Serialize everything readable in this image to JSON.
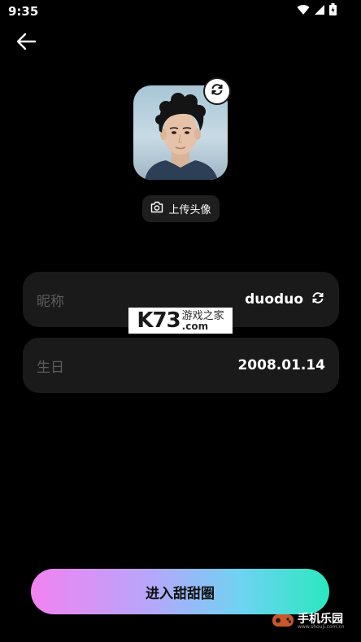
{
  "status_bar": {
    "time": "9:35"
  },
  "profile": {
    "upload_avatar_label": "上传头像"
  },
  "fields": [
    {
      "label": "昵称",
      "value": "duoduo"
    },
    {
      "label": "生日",
      "value": "2008.01.14"
    }
  ],
  "watermark": {
    "main": "K73",
    "cn": "游戏之家",
    "domain": ".com"
  },
  "enter_button": {
    "label": "进入甜甜圈"
  },
  "corner_logo": {
    "cn": "手机乐园",
    "url": "www.shouji.com.cn"
  },
  "colors": {
    "background": "#000000",
    "field_bg": "#1a1a1a",
    "label_gray": "#5d5d5d",
    "gradient_start": "#f282f0",
    "gradient_end": "#2ae8c0"
  },
  "icons": [
    "back-arrow-icon",
    "wifi-icon",
    "signal-icon",
    "battery-icon",
    "refresh-icon",
    "camera-icon"
  ]
}
